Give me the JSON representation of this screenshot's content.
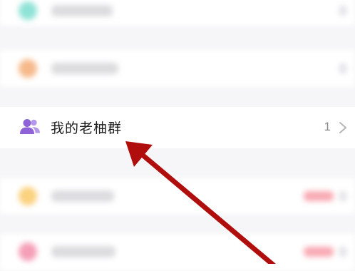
{
  "menu": {
    "focused_item": {
      "label": "我的老柚群",
      "count": "1",
      "icon": "group-icon"
    }
  },
  "colors": {
    "icon_purple": "#8e63d8",
    "arrow_red": "#b00d0d",
    "blur_teal": "#8fe3d6",
    "blur_orange": "#f7b98a",
    "blur_yellow": "#fbd27e",
    "blur_pink": "#f59fb8",
    "blur_badge_red": "#f8a8b2"
  }
}
